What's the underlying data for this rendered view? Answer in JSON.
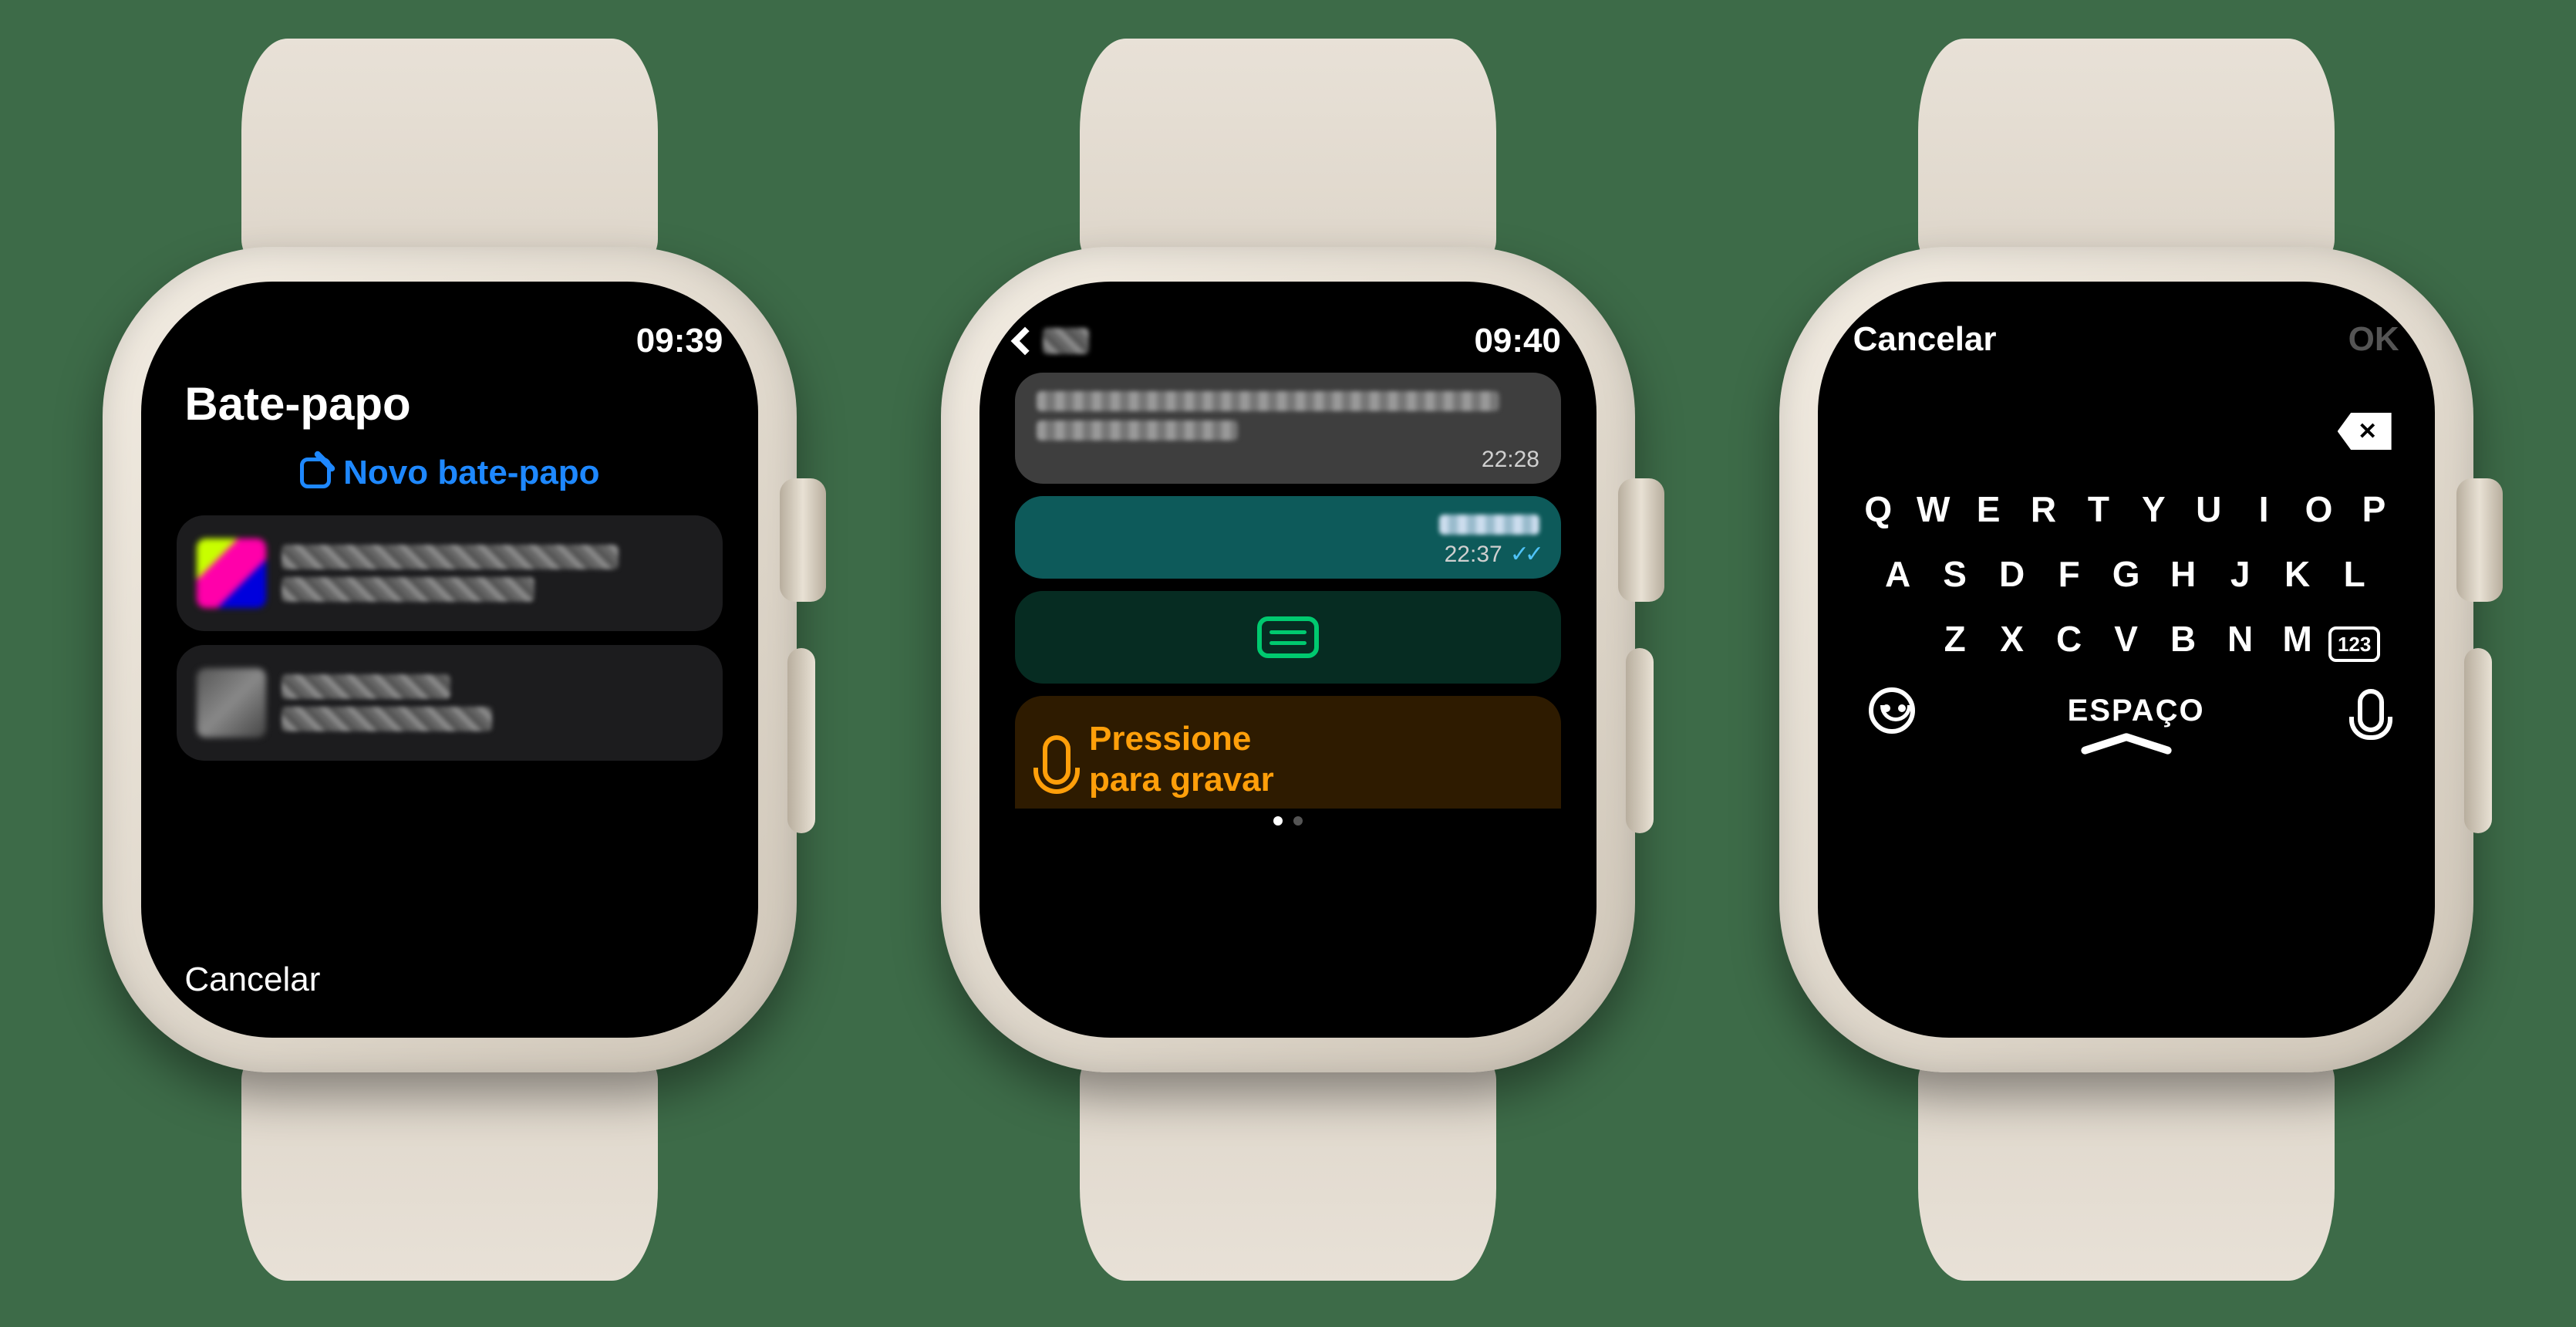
{
  "screen1": {
    "time": "09:39",
    "title": "Bate-papo",
    "new_chat_label": "Novo bate-papo",
    "cancel_label": "Cancelar"
  },
  "screen2": {
    "time": "09:40",
    "msg_in_time": "22:28",
    "msg_out_time": "22:37",
    "record_label_line1": "Pressione",
    "record_label_line2": "para gravar"
  },
  "screen3": {
    "cancel_label": "Cancelar",
    "ok_label": "OK",
    "row1": [
      "Q",
      "W",
      "E",
      "R",
      "T",
      "Y",
      "U",
      "I",
      "O",
      "P"
    ],
    "row2": [
      "A",
      "S",
      "D",
      "F",
      "G",
      "H",
      "J",
      "K",
      "L"
    ],
    "row3": [
      "Z",
      "X",
      "C",
      "V",
      "B",
      "N",
      "M"
    ],
    "num_key": "123",
    "space_label": "ESPAÇO"
  }
}
